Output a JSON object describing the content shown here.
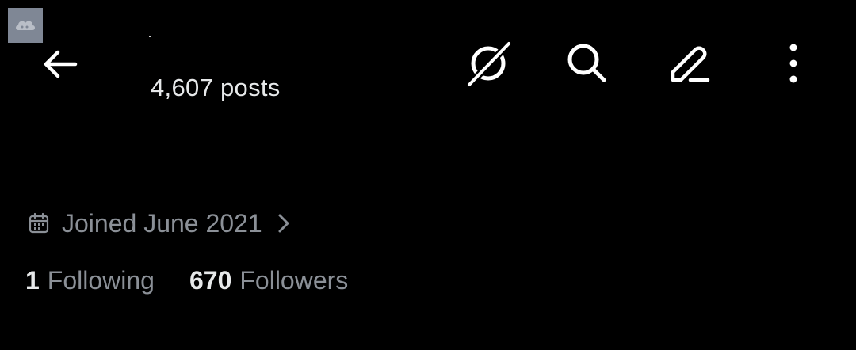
{
  "header": {
    "posts_count": "4,607 posts"
  },
  "icons": {
    "back": "arrow-left-icon",
    "grok": "grok-icon",
    "search": "search-icon",
    "compose": "compose-icon",
    "more": "more-vertical-icon",
    "calendar": "calendar-icon",
    "chevron": "chevron-right-icon"
  },
  "profile": {
    "joined": "Joined June 2021",
    "following_count": "1",
    "following_label": "Following",
    "followers_count": "670",
    "followers_label": "Followers"
  },
  "colors": {
    "background": "#000000",
    "primary_text": "#e7e9ea",
    "secondary_text": "#8b9097",
    "avatar_bg": "#7f8795"
  }
}
